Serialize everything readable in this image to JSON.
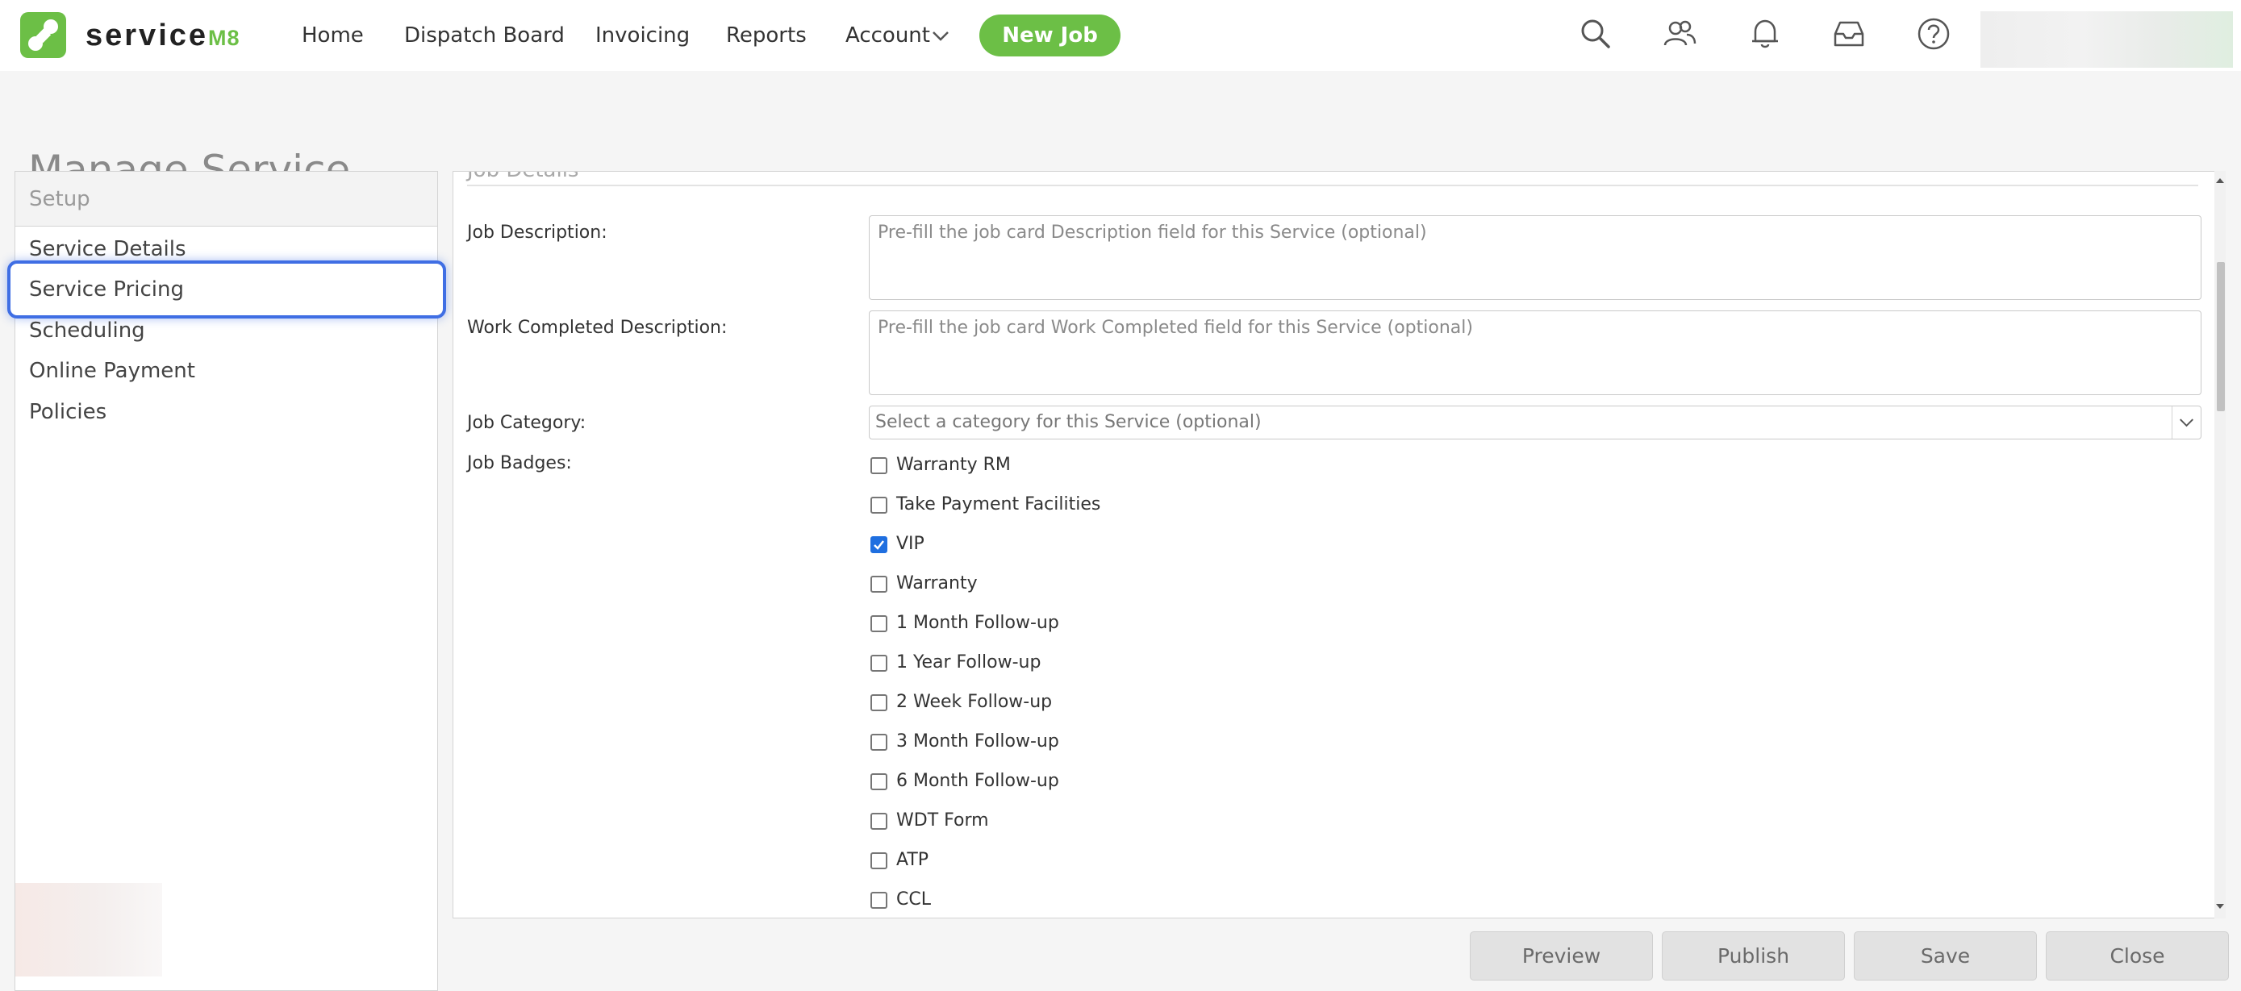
{
  "app": {
    "logo_name": "service",
    "logo_suffix": "M8",
    "brand_color": "#6cbf46"
  },
  "nav": {
    "items": [
      {
        "label": "Home"
      },
      {
        "label": "Dispatch Board"
      },
      {
        "label": "Invoicing"
      },
      {
        "label": "Reports"
      },
      {
        "label": "Account"
      }
    ],
    "new_job_label": "New Job",
    "icons": [
      "search-icon",
      "users-icon",
      "bell-icon",
      "inbox-icon",
      "help-icon"
    ]
  },
  "page": {
    "title": "Manage Service"
  },
  "sidebar": {
    "header": "Setup",
    "items": [
      {
        "label": "Service Details"
      },
      {
        "label": "Service Pricing",
        "highlighted": true
      },
      {
        "label": "Scheduling"
      },
      {
        "label": "Online Payment"
      },
      {
        "label": "Policies"
      }
    ],
    "highlight_color": "#3f6ee4"
  },
  "content": {
    "section_title": "Job Details",
    "job_description": {
      "label": "Job Description:",
      "value": "",
      "placeholder": "Pre-fill the job card Description field for this Service (optional)"
    },
    "work_completed": {
      "label": "Work Completed Description:",
      "value": "",
      "placeholder": "Pre-fill the job card Work Completed field for this Service (optional)"
    },
    "job_category": {
      "label": "Job Category:",
      "selected": "Select a category for this Service (optional)"
    },
    "job_badges": {
      "label": "Job Badges:",
      "items": [
        {
          "label": "Warranty RM",
          "checked": false
        },
        {
          "label": "Take Payment Facilities",
          "checked": false
        },
        {
          "label": "VIP",
          "checked": true
        },
        {
          "label": "Warranty",
          "checked": false
        },
        {
          "label": "1 Month Follow-up",
          "checked": false
        },
        {
          "label": "1 Year Follow-up",
          "checked": false
        },
        {
          "label": "2 Week Follow-up",
          "checked": false
        },
        {
          "label": "3 Month Follow-up",
          "checked": false
        },
        {
          "label": "6 Month Follow-up",
          "checked": false
        },
        {
          "label": " WDT Form",
          "checked": false
        },
        {
          "label": "ATP",
          "checked": false
        },
        {
          "label": "CCL",
          "checked": false
        }
      ]
    }
  },
  "footer": {
    "preview_label": "Preview",
    "publish_label": "Publish",
    "save_label": "Save",
    "close_label": "Close"
  }
}
